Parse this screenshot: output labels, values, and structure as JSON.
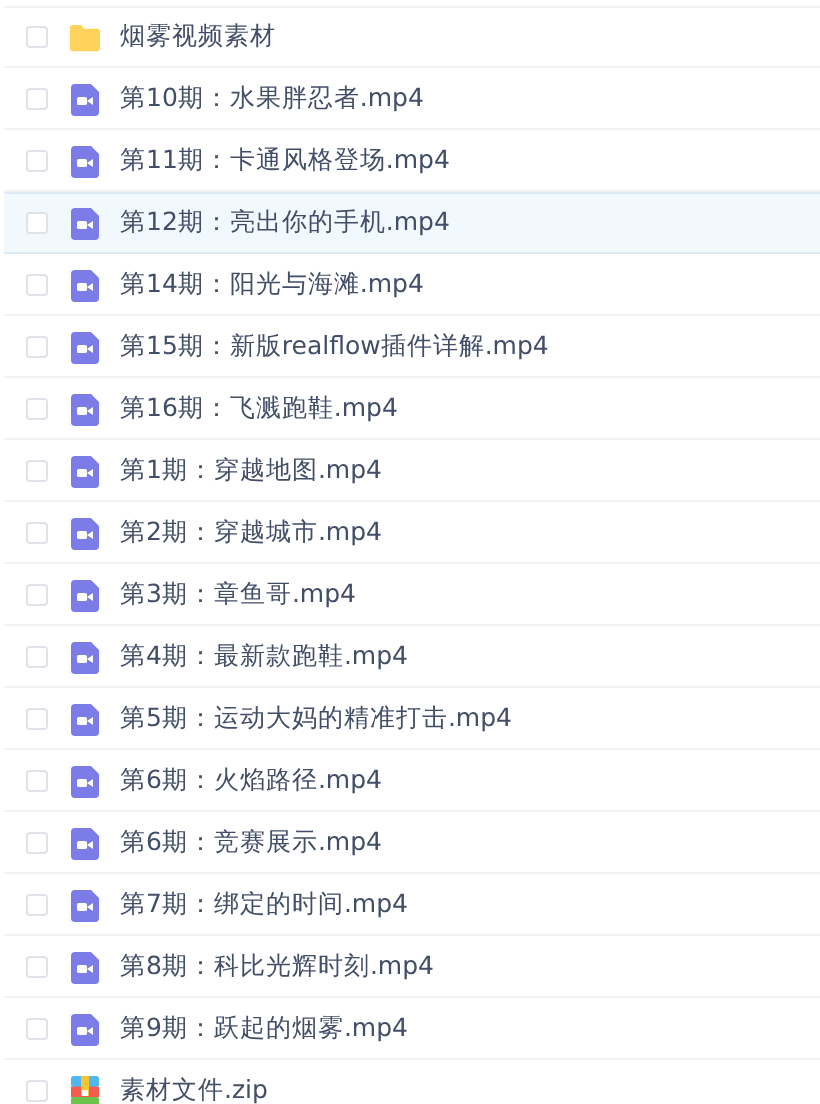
{
  "files": [
    {
      "kind": "folder",
      "name": "烟雾视频素材",
      "checked": false,
      "highlighted": false
    },
    {
      "kind": "video",
      "name": "第10期：水果胖忍者.mp4",
      "checked": false,
      "highlighted": false
    },
    {
      "kind": "video",
      "name": "第11期：卡通风格登场.mp4",
      "checked": false,
      "highlighted": false
    },
    {
      "kind": "video",
      "name": "第12期：亮出你的手机.mp4",
      "checked": false,
      "highlighted": true
    },
    {
      "kind": "video",
      "name": "第14期：阳光与海滩.mp4",
      "checked": false,
      "highlighted": false
    },
    {
      "kind": "video",
      "name": "第15期：新版realflow插件详解.mp4",
      "checked": false,
      "highlighted": false
    },
    {
      "kind": "video",
      "name": "第16期：飞溅跑鞋.mp4",
      "checked": false,
      "highlighted": false
    },
    {
      "kind": "video",
      "name": "第1期：穿越地图.mp4",
      "checked": false,
      "highlighted": false
    },
    {
      "kind": "video",
      "name": "第2期：穿越城市.mp4",
      "checked": false,
      "highlighted": false
    },
    {
      "kind": "video",
      "name": "第3期：章鱼哥.mp4",
      "checked": false,
      "highlighted": false
    },
    {
      "kind": "video",
      "name": "第4期：最新款跑鞋.mp4",
      "checked": false,
      "highlighted": false
    },
    {
      "kind": "video",
      "name": "第5期：运动大妈的精准打击.mp4",
      "checked": false,
      "highlighted": false
    },
    {
      "kind": "video",
      "name": "第6期：火焰路径.mp4",
      "checked": false,
      "highlighted": false
    },
    {
      "kind": "video",
      "name": "第6期：竞赛展示.mp4",
      "checked": false,
      "highlighted": false
    },
    {
      "kind": "video",
      "name": "第7期：绑定的时间.mp4",
      "checked": false,
      "highlighted": false
    },
    {
      "kind": "video",
      "name": "第8期：科比光辉时刻.mp4",
      "checked": false,
      "highlighted": false
    },
    {
      "kind": "video",
      "name": "第9期：跃起的烟雾.mp4",
      "checked": false,
      "highlighted": false
    },
    {
      "kind": "zip",
      "name": "素材文件.zip",
      "checked": false,
      "highlighted": false
    }
  ]
}
